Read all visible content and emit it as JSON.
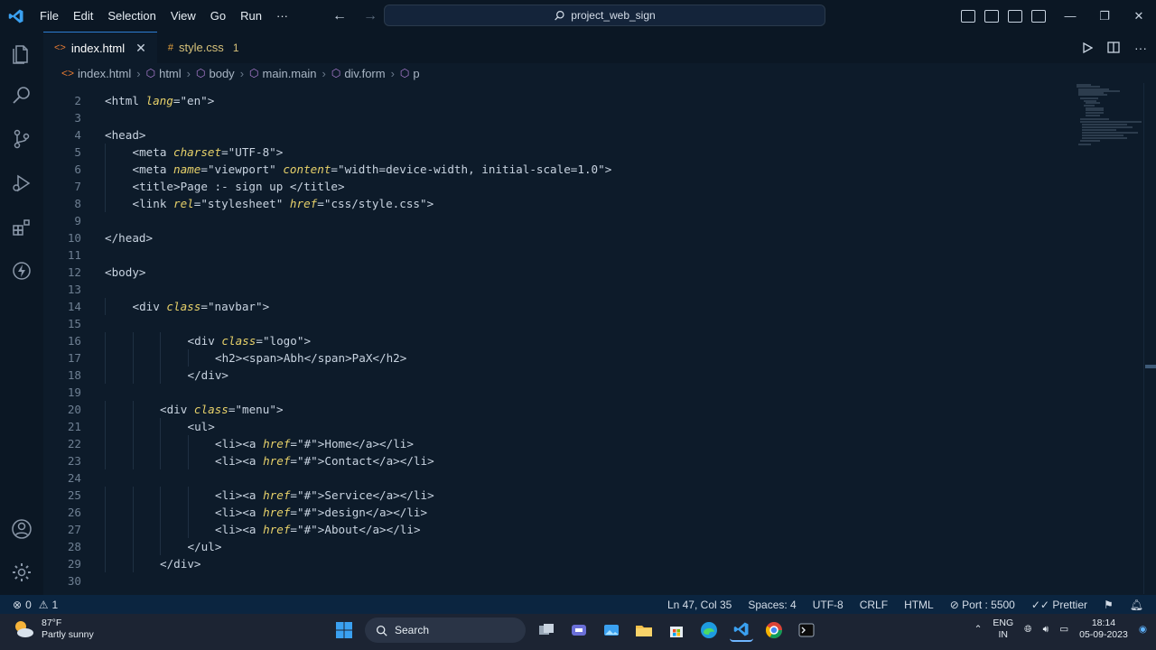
{
  "window": {
    "search_text": "project_web_sign",
    "menu": [
      "File",
      "Edit",
      "Selection",
      "View",
      "Go",
      "Run",
      "···"
    ]
  },
  "tabs": [
    {
      "label": "index.html",
      "glyph": "<>",
      "active": true
    },
    {
      "label": "style.css",
      "glyph": "#",
      "problems": "1"
    }
  ],
  "breadcrumb": [
    "index.html",
    "html",
    "body",
    "main.main",
    "div.form",
    "p"
  ],
  "editor": {
    "lines": [
      {
        "n": "2",
        "indent": 0,
        "tokens": [
          [
            "tag",
            "<html "
          ],
          [
            "attr",
            "lang"
          ],
          [
            "tag",
            "="
          ],
          [
            "str",
            "\"en\""
          ],
          [
            "tag",
            ">"
          ]
        ]
      },
      {
        "n": "3",
        "indent": 0,
        "tokens": []
      },
      {
        "n": "4",
        "indent": 0,
        "tokens": [
          [
            "tag",
            "<head>"
          ]
        ]
      },
      {
        "n": "5",
        "indent": 1,
        "tokens": [
          [
            "tag",
            "<meta "
          ],
          [
            "attr",
            "charset"
          ],
          [
            "tag",
            "="
          ],
          [
            "str",
            "\"UTF-8\""
          ],
          [
            "tag",
            ">"
          ]
        ]
      },
      {
        "n": "6",
        "indent": 1,
        "tokens": [
          [
            "tag",
            "<meta "
          ],
          [
            "attr",
            "name"
          ],
          [
            "tag",
            "="
          ],
          [
            "str",
            "\"viewport\" "
          ],
          [
            "attr",
            "content"
          ],
          [
            "tag",
            "="
          ],
          [
            "str",
            "\"width=device-width, initial-scale=1.0\""
          ],
          [
            "tag",
            ">"
          ]
        ]
      },
      {
        "n": "7",
        "indent": 1,
        "tokens": [
          [
            "tag",
            "<title>"
          ],
          [
            "str",
            "Page :- sign up "
          ],
          [
            "tag",
            "</title>"
          ]
        ]
      },
      {
        "n": "8",
        "indent": 1,
        "tokens": [
          [
            "tag",
            "<link "
          ],
          [
            "attr",
            "rel"
          ],
          [
            "tag",
            "="
          ],
          [
            "str",
            "\"stylesheet\" "
          ],
          [
            "attr",
            "href"
          ],
          [
            "tag",
            "="
          ],
          [
            "str",
            "\"css/style.css\""
          ],
          [
            "tag",
            ">"
          ]
        ]
      },
      {
        "n": "9",
        "indent": 0,
        "tokens": []
      },
      {
        "n": "10",
        "indent": 0,
        "tokens": [
          [
            "tag",
            "</head>"
          ]
        ]
      },
      {
        "n": "11",
        "indent": 0,
        "tokens": []
      },
      {
        "n": "12",
        "indent": 0,
        "tokens": [
          [
            "tag",
            "<body>"
          ]
        ]
      },
      {
        "n": "13",
        "indent": 0,
        "tokens": []
      },
      {
        "n": "14",
        "indent": 1,
        "tokens": [
          [
            "tag",
            "<div "
          ],
          [
            "attr",
            "class"
          ],
          [
            "tag",
            "="
          ],
          [
            "str",
            "\"navbar\""
          ],
          [
            "tag",
            ">"
          ]
        ]
      },
      {
        "n": "15",
        "indent": 0,
        "tokens": []
      },
      {
        "n": "16",
        "indent": 3,
        "tokens": [
          [
            "tag",
            "<div "
          ],
          [
            "attr",
            "class"
          ],
          [
            "tag",
            "="
          ],
          [
            "str",
            "\"logo\""
          ],
          [
            "tag",
            ">"
          ]
        ]
      },
      {
        "n": "17",
        "indent": 4,
        "tokens": [
          [
            "tag",
            "<h2><span>"
          ],
          [
            "str",
            "Abh"
          ],
          [
            "tag",
            "</span>"
          ],
          [
            "str",
            "PaX"
          ],
          [
            "tag",
            "</h2>"
          ]
        ]
      },
      {
        "n": "18",
        "indent": 3,
        "tokens": [
          [
            "tag",
            "</div>"
          ]
        ]
      },
      {
        "n": "19",
        "indent": 0,
        "tokens": []
      },
      {
        "n": "20",
        "indent": 2,
        "tokens": [
          [
            "tag",
            "<div "
          ],
          [
            "attr",
            "class"
          ],
          [
            "tag",
            "="
          ],
          [
            "str",
            "\"menu\""
          ],
          [
            "tag",
            ">"
          ]
        ]
      },
      {
        "n": "21",
        "indent": 3,
        "tokens": [
          [
            "tag",
            "<ul>"
          ]
        ]
      },
      {
        "n": "22",
        "indent": 4,
        "tokens": [
          [
            "tag",
            "<li><a "
          ],
          [
            "attr",
            "href"
          ],
          [
            "tag",
            "="
          ],
          [
            "str",
            "\"#\""
          ],
          [
            "tag",
            ">"
          ],
          [
            "str",
            "Home"
          ],
          [
            "tag",
            "</a></li>"
          ]
        ]
      },
      {
        "n": "23",
        "indent": 4,
        "tokens": [
          [
            "tag",
            "<li><a "
          ],
          [
            "attr",
            "href"
          ],
          [
            "tag",
            "="
          ],
          [
            "str",
            "\"#\""
          ],
          [
            "tag",
            ">"
          ],
          [
            "str",
            "Contact"
          ],
          [
            "tag",
            "</a></li>"
          ]
        ]
      },
      {
        "n": "24",
        "indent": 0,
        "tokens": []
      },
      {
        "n": "25",
        "indent": 4,
        "tokens": [
          [
            "tag",
            "<li><a "
          ],
          [
            "attr",
            "href"
          ],
          [
            "tag",
            "="
          ],
          [
            "str",
            "\"#\""
          ],
          [
            "tag",
            ">"
          ],
          [
            "str",
            "Service"
          ],
          [
            "tag",
            "</a></li>"
          ]
        ]
      },
      {
        "n": "26",
        "indent": 4,
        "tokens": [
          [
            "tag",
            "<li><a "
          ],
          [
            "attr",
            "href"
          ],
          [
            "tag",
            "="
          ],
          [
            "str",
            "\"#\""
          ],
          [
            "tag",
            ">"
          ],
          [
            "str",
            "design"
          ],
          [
            "tag",
            "</a></li>"
          ]
        ]
      },
      {
        "n": "27",
        "indent": 4,
        "tokens": [
          [
            "tag",
            "<li><a "
          ],
          [
            "attr",
            "href"
          ],
          [
            "tag",
            "="
          ],
          [
            "str",
            "\"#\""
          ],
          [
            "tag",
            ">"
          ],
          [
            "str",
            "About"
          ],
          [
            "tag",
            "</a></li>"
          ]
        ]
      },
      {
        "n": "28",
        "indent": 3,
        "tokens": [
          [
            "tag",
            "</ul>"
          ]
        ]
      },
      {
        "n": "29",
        "indent": 2,
        "tokens": [
          [
            "tag",
            "</div>"
          ]
        ]
      },
      {
        "n": "30",
        "indent": 0,
        "tokens": []
      }
    ]
  },
  "status": {
    "errors": "0",
    "warnings": "1",
    "position": "Ln 47, Col 35",
    "spaces": "Spaces: 4",
    "encoding": "UTF-8",
    "eol": "CRLF",
    "language": "HTML",
    "port": "Port : 5500",
    "formatter": "Prettier"
  },
  "taskbar": {
    "temperature": "87°F",
    "weather": "Partly sunny",
    "search_label": "Search",
    "lang_top": "ENG",
    "lang_bottom": "IN",
    "time": "18:14",
    "date": "05-09-2023"
  },
  "colors": {
    "accent": "#2d7dd2",
    "attribute": "#e7d16a",
    "editor_bg": "#0d1b2a"
  }
}
